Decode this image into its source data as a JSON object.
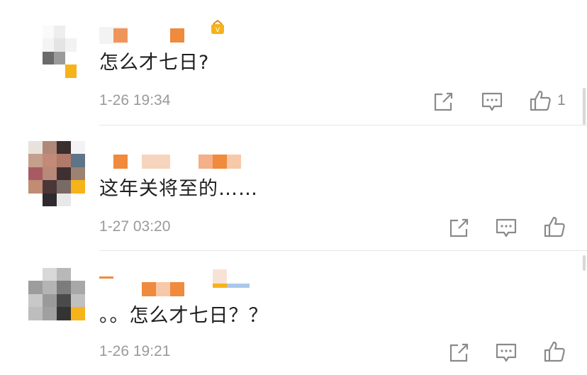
{
  "comments": [
    {
      "text": "怎么才七日?",
      "time": "1-26 19:34",
      "like_count": "1"
    },
    {
      "text": "这年关将至的……",
      "time": "1-27 03:20",
      "like_count": ""
    },
    {
      "text": "。。怎么才七日？？",
      "time": "1-26 19:21",
      "like_count": ""
    }
  ],
  "icons": {
    "share": "share-icon",
    "reply": "comment-icon",
    "like": "thumbs-up-icon",
    "badge": "vip-badge-icon"
  },
  "colors": {
    "name_orange": "#f08a3c",
    "accent_yellow": "#f6b31a",
    "text": "#1f1f1f",
    "meta": "#9a9a9a"
  }
}
